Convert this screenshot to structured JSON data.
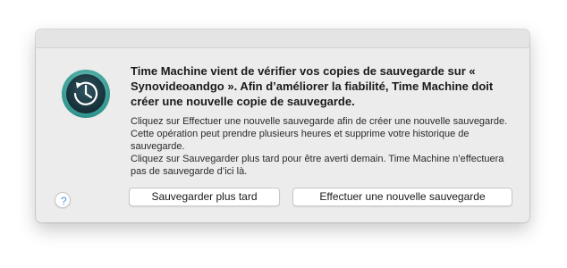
{
  "dialog": {
    "icon": "time-machine-icon",
    "headline": "Time Machine vient de vérifier vos copies de sauvegarde sur « Synovideoandgo ». Afin d’améliorer la fiabilité, Time Machine doit créer une nouvelle copie de sauvegarde.",
    "paragraphs": [
      "Cliquez sur Effectuer une nouvelle sauvegarde afin de créer une nouvelle sauvegarde. Cette opération peut prendre plusieurs heures et supprime votre historique de sauvegarde.",
      "Cliquez sur Sauvegarder plus tard pour être averti demain. Time Machine n’effectuera pas de sauvegarde d’ici là."
    ],
    "help_label": "?",
    "buttons": {
      "later_label": "Sauvegarder plus tard",
      "backup_label": "Effectuer une nouvelle sauvegarde"
    }
  },
  "colors": {
    "dialog_background": "#ececec",
    "icon_ring": "#3aa6a0",
    "icon_face": "#1c3a44",
    "help_accent": "#4a90e2"
  }
}
